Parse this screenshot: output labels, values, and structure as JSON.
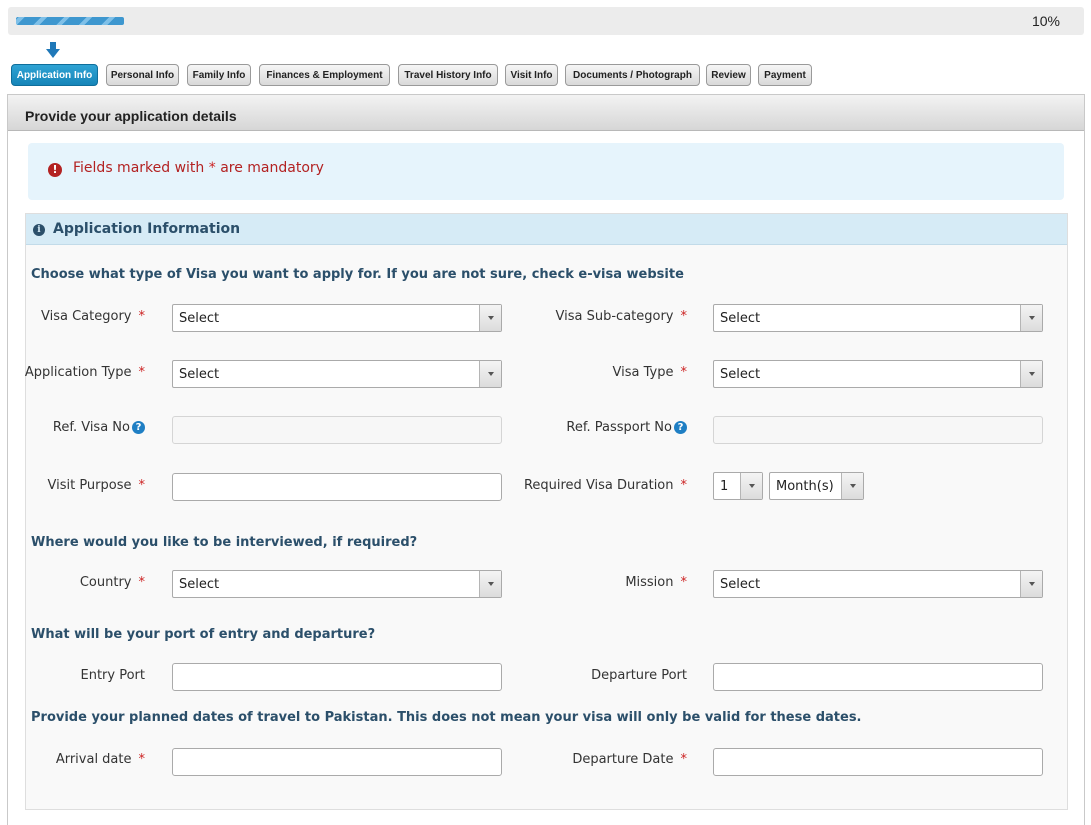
{
  "progress": {
    "percent_text": "10%",
    "value": 0.1
  },
  "steps": [
    {
      "label": "Application Info",
      "active": true
    },
    {
      "label": "Personal Info",
      "active": false
    },
    {
      "label": "Family Info",
      "active": false
    },
    {
      "label": "Finances & Employment",
      "active": false
    },
    {
      "label": "Travel History Info",
      "active": false
    },
    {
      "label": "Visit Info",
      "active": false
    },
    {
      "label": "Documents / Photograph",
      "active": false
    },
    {
      "label": "Review",
      "active": false
    },
    {
      "label": "Payment",
      "active": false
    }
  ],
  "panel": {
    "title": "Provide your application details"
  },
  "alert": {
    "prefix": "Fields marked with",
    "star": "*",
    "suffix": "are mandatory"
  },
  "section": {
    "title": "Application Information",
    "visa_heading": "Choose what type of Visa you want to apply for. If you are not sure, check e-visa website",
    "interview_heading": "Where would you like to be interviewed, if required?",
    "port_heading": "What will be your port of entry and departure?",
    "dates_heading": "Provide your planned dates of travel to Pakistan. This does not mean your visa will only be valid for these dates."
  },
  "fields": {
    "visa_category": {
      "label": "Visa Category",
      "value": "Select",
      "required": "*"
    },
    "visa_subcategory": {
      "label": "Visa Sub-category",
      "value": "Select",
      "required": "*"
    },
    "application_type": {
      "label": "Application Type",
      "value": "Select",
      "required": "*"
    },
    "visa_type": {
      "label": "Visa Type",
      "value": "Select",
      "required": "*"
    },
    "ref_visa_no": {
      "label": "Ref. Visa No",
      "value": ""
    },
    "ref_passport_no": {
      "label": "Ref. Passport No",
      "value": ""
    },
    "visit_purpose": {
      "label": "Visit Purpose",
      "value": "",
      "required": "*"
    },
    "visa_duration": {
      "label": "Required Visa Duration",
      "required": "*",
      "number": "1",
      "unit": "Month(s)"
    },
    "country": {
      "label": "Country",
      "value": "Select",
      "required": "*"
    },
    "mission": {
      "label": "Mission",
      "value": "Select",
      "required": "*"
    },
    "entry_port": {
      "label": "Entry Port",
      "value": ""
    },
    "departure_port": {
      "label": "Departure Port",
      "value": ""
    },
    "arrival_date": {
      "label": "Arrival date",
      "value": "",
      "required": "*"
    },
    "departure_date": {
      "label": "Departure Date",
      "value": "",
      "required": "*"
    }
  },
  "icons": {
    "help": "question-circle-icon",
    "info": "info-circle-icon",
    "alert": "exclamation-circle-icon",
    "step": "arrow-down-icon"
  },
  "colors": {
    "accent": "#1685b8",
    "required": "#cc2222",
    "section_header": "#d6ebf6",
    "alert_bg": "#e6f4fc"
  }
}
